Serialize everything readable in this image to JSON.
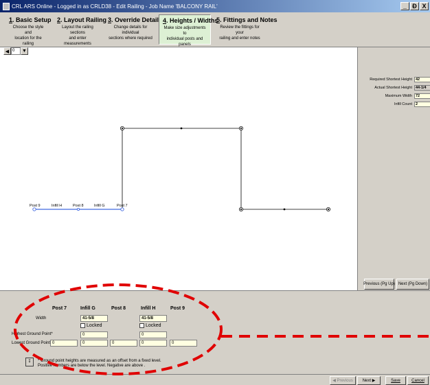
{
  "window": {
    "title": "CRL ARS Online - Logged in as CRLD38 - Edit Railing - Job Name 'BALCONY RAIL'",
    "minimize": "_",
    "restore": "Ɖ",
    "close": "X"
  },
  "tabs": [
    {
      "num": "1",
      "rest": ". Basic Setup",
      "desc1": "Choose the style and",
      "desc2": "location for the railing"
    },
    {
      "num": "2",
      "rest": ". Layout Railing",
      "desc1": "Layout the railing sections",
      "desc2": "and enter measurements"
    },
    {
      "num": "3",
      "rest": ". Override Details",
      "desc1": "Change details for individual",
      "desc2": "sections where required"
    },
    {
      "num": "4",
      "rest": ". Heights / Widths",
      "desc1": "Make size adjustments to",
      "desc2": "individual posts and panels"
    },
    {
      "num": "5",
      "rest": ". Fittings and Notes",
      "desc1": "Review the fittings for your",
      "desc2": "railing and enter notes"
    }
  ],
  "canvas": {
    "zoom_value": "0",
    "labels": {
      "post9": "Post 9",
      "infillH": "Infill H",
      "post8": "Post 8",
      "infillG": "Infill G",
      "post7": "Post 7"
    }
  },
  "right_panel": {
    "required_label": "Required Shortest Height",
    "required_value": "42",
    "actual_label": "Actual Shortest Height",
    "actual_value": "44-1/4",
    "maxwidth_label": "Maximum Width",
    "maxwidth_value": "72",
    "infill_label": "Infill Count",
    "infill_value": "2",
    "prev_button": "Previous (Pg Up)",
    "next_button": "Next (Pg Down)"
  },
  "bottom": {
    "columns": [
      "Post 7",
      "Infill G",
      "Post 8",
      "Infill H",
      "Post 9"
    ],
    "width_label": "Width",
    "width_g": "41-5/8",
    "width_h": "41-5/8",
    "locked_label": "Locked",
    "highest_label": "Highest Ground Point*",
    "highest_g": "0",
    "highest_h": "0",
    "lowest_label": "Lowest Ground Point*",
    "lowest_values": [
      "0",
      "0",
      "0",
      "0",
      "0"
    ],
    "info_line1": "* Ground point heights are measured as an offset from a fixed level.",
    "info_line2": "Positive numbers are below the level. Negative are above ."
  },
  "status": {
    "previous": "Previous",
    "next": "Next",
    "save": "Save",
    "cancel": "Cancel"
  },
  "colors": {
    "active_tab": "#ddf0d4",
    "input_bg": "#ffffe1",
    "selected_line": "#4169e1",
    "annotation": "#e00000"
  }
}
